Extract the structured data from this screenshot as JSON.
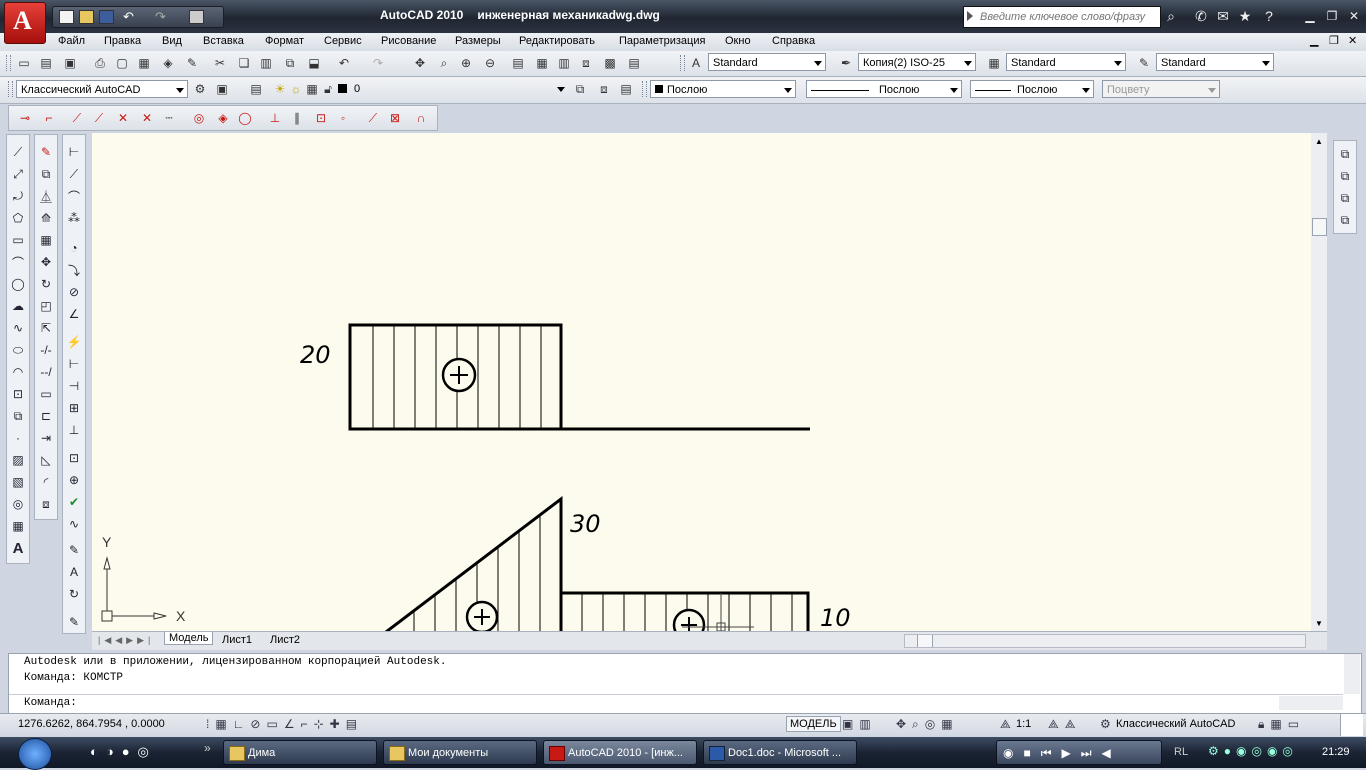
{
  "window": {
    "app_title": "AutoCAD 2010",
    "file_title": "инженерная механикаdwg.dwg"
  },
  "search": {
    "placeholder": "Введите ключевое слово/фразу"
  },
  "menu": {
    "items": [
      "Файл",
      "Правка",
      "Вид",
      "Вставка",
      "Формат",
      "Сервис",
      "Рисование",
      "Размеры",
      "Редактировать",
      "Параметризация",
      "Окно",
      "Справка"
    ]
  },
  "toolbar_standard": {
    "text_style": "Standard",
    "dim_style": "Копия(2) ISO-25",
    "table_style": "Standard",
    "multileader_style": "Standard"
  },
  "toolbar_layers": {
    "workspace": "Классический AutoCAD",
    "layer": "0",
    "color": "Послою",
    "linetype": "Послою",
    "lineweight": "Послою",
    "plotstyle": "Поцвету"
  },
  "drawing": {
    "dim_labels": [
      "20",
      "30",
      "10"
    ],
    "ucs_x": "X",
    "ucs_y": "Y"
  },
  "layout_tabs": [
    "Модель",
    "Лист1",
    "Лист2"
  ],
  "command": {
    "line1": "Autodesk или в приложении, лицензированном корпорацией Autodesk.",
    "line2": "Команда: КОМСТР",
    "prompt": "Команда:"
  },
  "status": {
    "coords": "1276.6262, 864.7954 , 0.0000",
    "model": "МОДЕЛЬ",
    "scale": "1:1",
    "workspace": "Классический AutoCAD"
  },
  "taskbar": {
    "buttons": [
      "Дима",
      "Мои документы",
      "AutoCAD 2010 - [инж...",
      "Doc1.doc - Microsoft ..."
    ],
    "lang": "RL",
    "clock": "21:29"
  },
  "colors": {
    "canvas_bg": "#fcfbee",
    "accent_red": "#c81a14"
  }
}
